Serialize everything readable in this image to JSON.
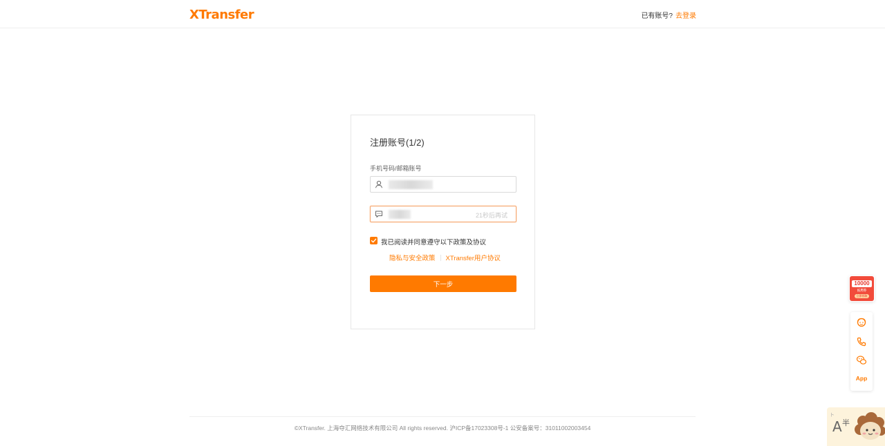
{
  "header": {
    "logo": "XTransfer",
    "has_account": "已有账号?",
    "login_link": "去登录"
  },
  "form": {
    "title": "注册账号(1/2)",
    "account_label": "手机号码/邮箱账号",
    "countdown": "21秒后再试",
    "agree_text": "我已阅读并同意遵守以下政策及协议",
    "agree_checked": true,
    "privacy_link": "隐私与安全政策",
    "user_agreement_link": "XTransfer用户协议",
    "next_button": "下一步"
  },
  "footer": {
    "text": "©XTransfer. 上海夺汇网络技术有限公司 All rights reserved. 沪ICP备17023308号-1 公安备案号：31011002003454"
  },
  "side_promo": {
    "amount": "10000",
    "sub1": "抵用券",
    "sub2": "立即领取"
  },
  "sidebar": {
    "items": [
      {
        "icon": "customer-service-icon"
      },
      {
        "icon": "phone-icon"
      },
      {
        "icon": "wechat-icon"
      }
    ],
    "app_label": "App"
  },
  "mascot": {
    "text": "A",
    "small": "半",
    "ear": "ト"
  },
  "colors": {
    "brand": "#ff7a00",
    "promo_red": "#f24b3b",
    "text": "#333333",
    "muted": "#888888"
  }
}
